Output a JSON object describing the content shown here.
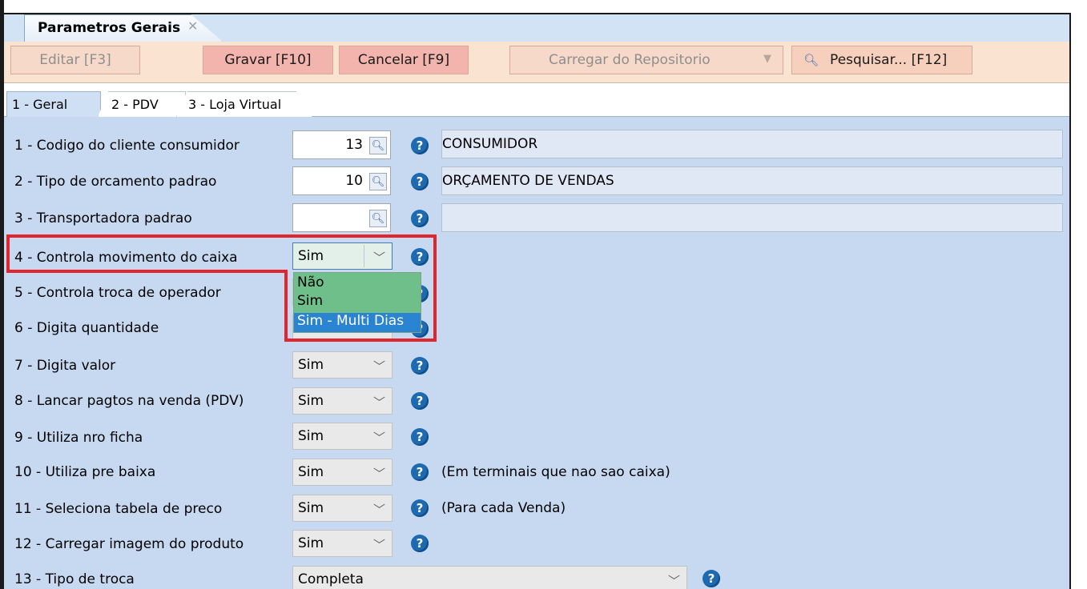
{
  "window": {
    "tab_title": "Parametros Gerais",
    "tab_close": "✕"
  },
  "toolbar": {
    "edit_label": "Editar [F3]",
    "save_label": "Gravar [F10]",
    "cancel_label": "Cancelar [F9]",
    "repo_label": "Carregar do Repositorio",
    "search_label": "Pesquisar... [F12]"
  },
  "subtabs": [
    {
      "label": "1 - Geral"
    },
    {
      "label": "2 - PDV"
    },
    {
      "label": "3 - Loja Virtual"
    }
  ],
  "rows": {
    "r1": {
      "label": "1 - Codigo do cliente consumidor",
      "code": "13",
      "desc": "CONSUMIDOR"
    },
    "r2": {
      "label": "2 - Tipo de orcamento padrao",
      "code": "10",
      "desc": "ORÇAMENTO DE VENDAS"
    },
    "r3": {
      "label": "3 - Transportadora padrao",
      "code": "",
      "desc": ""
    },
    "r4": {
      "label": "4 - Controla movimento do caixa",
      "value": "Sim"
    },
    "r5": {
      "label": "5 - Controla troca de operador"
    },
    "r6": {
      "label": "6 - Digita quantidade"
    },
    "r7": {
      "label": "7 - Digita valor",
      "value": "Sim"
    },
    "r8": {
      "label": "8 - Lancar pagtos na venda (PDV)",
      "value": "Sim"
    },
    "r9": {
      "label": "9 - Utiliza nro ficha",
      "value": "Sim"
    },
    "r10": {
      "label": "10 - Utiliza pre baixa",
      "value": "Sim",
      "note": "(Em terminais que nao sao caixa)"
    },
    "r11": {
      "label": "11 - Seleciona tabela de preco",
      "value": "Sim",
      "note": "(Para cada Venda)"
    },
    "r12": {
      "label": "12 - Carregar imagem do produto",
      "value": "Sim"
    },
    "r13": {
      "label": "13 - Tipo de troca",
      "value": "Completa"
    }
  },
  "dropdown": {
    "options": [
      "Não",
      "Sim",
      "Sim - Multi Dias"
    ],
    "selected": "Sim - Multi Dias"
  },
  "colors": {
    "highlight": "#e2252d",
    "content_bg": "#c6d9f1",
    "toolbar_bg": "#fbe3d2",
    "help_icon": "#1e6ab0"
  }
}
